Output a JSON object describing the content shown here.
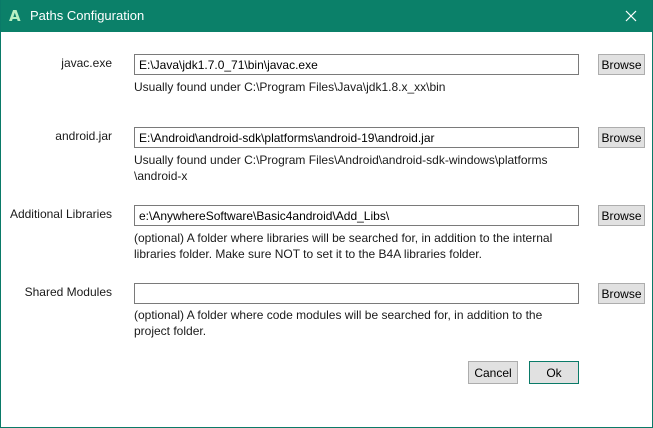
{
  "window": {
    "title": "Paths Configuration",
    "app_icon_glyph": "A",
    "accent_color": "#0b8069"
  },
  "rows": [
    {
      "label": "javac.exe",
      "value": "E:\\Java\\jdk1.7.0_71\\bin\\javac.exe",
      "hint_lines": [
        "Usually found under C:\\Program Files\\Java\\jdk1.8.x_xx\\bin"
      ],
      "browse_label": "Browse"
    },
    {
      "label": "android.jar",
      "value": "E:\\Android\\android-sdk\\platforms\\android-19\\android.jar",
      "hint_lines": [
        "Usually found under C:\\Program Files\\Android\\android-sdk-windows\\platforms",
        "\\android-x"
      ],
      "browse_label": "Browse"
    },
    {
      "label": "Additional Libraries",
      "value": "e:\\AnywhereSoftware\\Basic4android\\Add_Libs\\",
      "hint_lines": [
        "(optional) A folder where libraries will be searched for, in addition to the internal",
        "libraries folder. Make sure NOT to set it to the B4A libraries folder."
      ],
      "browse_label": "Browse"
    },
    {
      "label": "Shared Modules",
      "value": "",
      "hint_lines": [
        "(optional) A folder where code modules will be searched for, in addition to the",
        "project folder."
      ],
      "browse_label": "Browse"
    }
  ],
  "buttons": {
    "cancel_label": "Cancel",
    "ok_label": "Ok"
  }
}
